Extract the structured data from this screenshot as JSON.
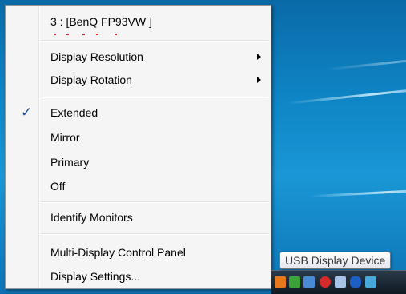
{
  "menu": {
    "header": "3 : [BenQ FP93VW ]",
    "items": [
      {
        "label": "Display Resolution",
        "submenu": true
      },
      {
        "label": "Display Rotation",
        "submenu": true
      },
      {
        "label": "Extended",
        "checked": true
      },
      {
        "label": "Mirror"
      },
      {
        "label": "Primary"
      },
      {
        "label": "Off"
      },
      {
        "label": "Identify Monitors"
      },
      {
        "label": "Multi-Display Control Panel"
      },
      {
        "label": "Display Settings..."
      }
    ],
    "check_glyph": "✓"
  },
  "tooltip": {
    "text": "USB Display Device"
  },
  "tray": {
    "icons": [
      "usb-display-icon",
      "shield-icon",
      "network-icon",
      "error-icon",
      "monitor-icon",
      "bluetooth-icon",
      "network-activity-icon"
    ]
  },
  "colors": {
    "check": "#1a4fa0",
    "menu_bg": "#f5f5f5",
    "desktop": "#0f86c6"
  }
}
